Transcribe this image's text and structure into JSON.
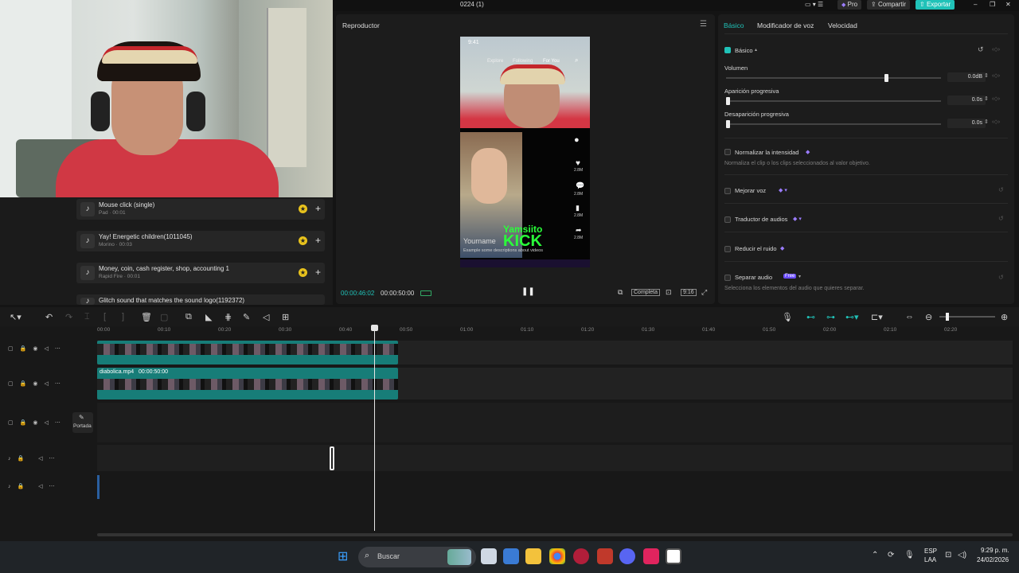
{
  "window": {
    "title": "0224 (1)",
    "pro": "Pro",
    "share": "Compartir",
    "export": "Exportar"
  },
  "media": {
    "items": [
      {
        "title": "Mouse click (single)",
        "sub": "Pad · 00:01"
      },
      {
        "title": "Yay! Energetic children(1011045)",
        "sub": "Morino · 00:03"
      },
      {
        "title": "Money, coin, cash register, shop, accounting 1",
        "sub": "Rapid Fire · 00:01"
      },
      {
        "title": "Glitch sound that matches the sound logo(1192372)",
        "sub": ""
      }
    ]
  },
  "player": {
    "title": "Reproductor",
    "current": "00:00:46:02",
    "total": "00:00:50:00",
    "full": "Completa",
    "ratio": "9:16",
    "phone": {
      "time": "9:41",
      "tabs": [
        "Explore",
        "Following",
        "For You"
      ],
      "overlay1": "Yamsiito",
      "overlay2": "KICK",
      "username": "Yourname",
      "desc": "Example some descriptions about videos",
      "counts": [
        "2.8M",
        "2.8M",
        "2.8M",
        "2.8M"
      ]
    }
  },
  "inspector": {
    "tabs": [
      "Básico",
      "Modificador de voz",
      "Velocidad"
    ],
    "section": "Básico",
    "volume": {
      "label": "Volumen",
      "value": "0.0dB",
      "level": 0.75
    },
    "fadein": {
      "label": "Aparición progresiva",
      "value": "0.0s"
    },
    "fadeout": {
      "label": "Desaparición progresiva",
      "value": "0.0s"
    },
    "normalize": {
      "label": "Normalizar la intensidad",
      "desc": "Normaliza el clip o los clips seleccionados al valor objetivo."
    },
    "enhance": {
      "label": "Mejorar voz"
    },
    "translator": {
      "label": "Traductor de audios"
    },
    "noise": {
      "label": "Reducir el ruido"
    },
    "separate": {
      "label": "Separar audio",
      "badge": "Free",
      "desc": "Selecciona los elementos del audio que quieres separar."
    }
  },
  "timeline": {
    "ticks": [
      "00:00",
      "00:10",
      "00:20",
      "00:30",
      "00:40",
      "00:50",
      "01:00",
      "01:10",
      "01:20",
      "01:30",
      "01:40",
      "01:50",
      "02:00",
      "02:10",
      "02:20"
    ],
    "clip_label": "diabolica.mp4",
    "clip_duration": "00:00:50:00",
    "cover": "Portada"
  },
  "taskbar": {
    "search": "Buscar",
    "lang1": "ESP",
    "lang2": "LAA",
    "time": "9:29 p. m.",
    "date": "24/02/2026"
  },
  "colors": {
    "accent": "#20c2b8",
    "clip": "#177d78",
    "premium": "#9b7cff"
  }
}
